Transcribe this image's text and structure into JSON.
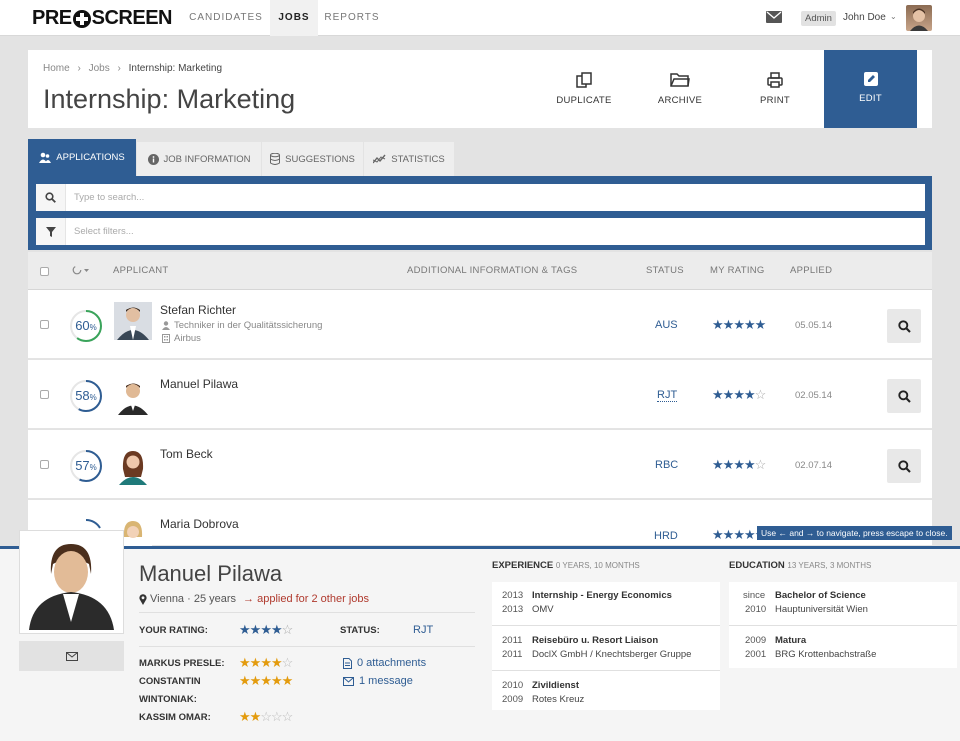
{
  "nav": {
    "logo_left": "PRE",
    "logo_right": "SCREEN",
    "tabs": [
      "CANDIDATES",
      "JOBS",
      "REPORTS"
    ],
    "role_badge": "Admin",
    "user_name": "John Doe",
    "caret": "⌄"
  },
  "header": {
    "breadcrumb": [
      "Home",
      "Jobs",
      "Internship: Marketing"
    ],
    "breadcrumb_sep": "›",
    "title": "Internship: Marketing",
    "actions": [
      "DUPLICATE",
      "ARCHIVE",
      "PRINT",
      "EDIT"
    ]
  },
  "tabs": [
    "APPLICATIONS",
    "JOB INFORMATION",
    "SUGGESTIONS",
    "STATISTICS"
  ],
  "search": {
    "placeholder": "Type to search..."
  },
  "filters": {
    "placeholder": "Select filters..."
  },
  "table": {
    "columns": [
      "APPLICANT",
      "ADDITIONAL INFORMATION & TAGS",
      "STATUS",
      "MY RATING",
      "APPLIED"
    ],
    "rows": [
      {
        "score": "60",
        "unit": "%",
        "fraction": 0.6,
        "ring_color": "#3aa45b",
        "name": "Stefan Richter",
        "job": "Techniker in der Qualitätssicherung",
        "company": "Airbus",
        "status": "AUS",
        "rating": 5,
        "applied": "05.05.14"
      },
      {
        "score": "58",
        "unit": "%",
        "fraction": 0.58,
        "ring_color": "#2f5d93",
        "name": "Manuel Pilawa",
        "status": "RJT",
        "rating": 4,
        "applied": "02.05.14"
      },
      {
        "score": "57",
        "unit": "%",
        "fraction": 0.57,
        "ring_color": "#2f5d93",
        "name": "Tom Beck",
        "status": "RBC",
        "rating": 4,
        "applied": "02.07.14"
      },
      {
        "name": "Maria Dobrova",
        "status": "HRD",
        "rating": 5
      }
    ]
  },
  "tooltip": "Use ← and → to navigate, press escape to close.",
  "detail": {
    "name": "Manuel Pilawa",
    "location": "Vienna · 25 years",
    "other_jobs": "→ applied for 2 other jobs",
    "your_rating_label": "YOUR RATING:",
    "your_rating": 4,
    "status_label": "STATUS:",
    "status": "RJT",
    "other_ratings": [
      {
        "label": "MARKUS PRESLE:",
        "rating": 4
      },
      {
        "label": "CONSTANTIN",
        "rating": 5
      },
      {
        "label": "WINTONIAK:",
        "rating": null
      },
      {
        "label": "KASSIM OMAR:",
        "rating": 2
      }
    ],
    "attachments": "0 attachments",
    "messages": "1 message",
    "experience_title": "EXPERIENCE",
    "experience_duration": "0 YEARS, 10 MONTHS",
    "experience": [
      {
        "y1": "2013",
        "title": "Internship - Energy Economics",
        "y2": "2013",
        "org": "OMV"
      },
      {
        "y1": "2011",
        "title": "Reisebüro u. Resort Liaison",
        "y2": "2011",
        "org": "DoclX GmbH / Knechtsberger Gruppe"
      },
      {
        "y1": "2010",
        "title": "Zivildienst",
        "y2": "2009",
        "org": "Rotes Kreuz"
      }
    ],
    "education_title": "EDUCATION",
    "education_duration": "13 YEARS, 3 MONTHS",
    "education": [
      {
        "y1": "since",
        "title": "Bachelor of Science",
        "y2": "2010",
        "org": "Hauptuniversität Wien"
      },
      {
        "y1": "2009",
        "title": "Matura",
        "y2": "2001",
        "org": "BRG Krottenbachstraße"
      }
    ]
  }
}
